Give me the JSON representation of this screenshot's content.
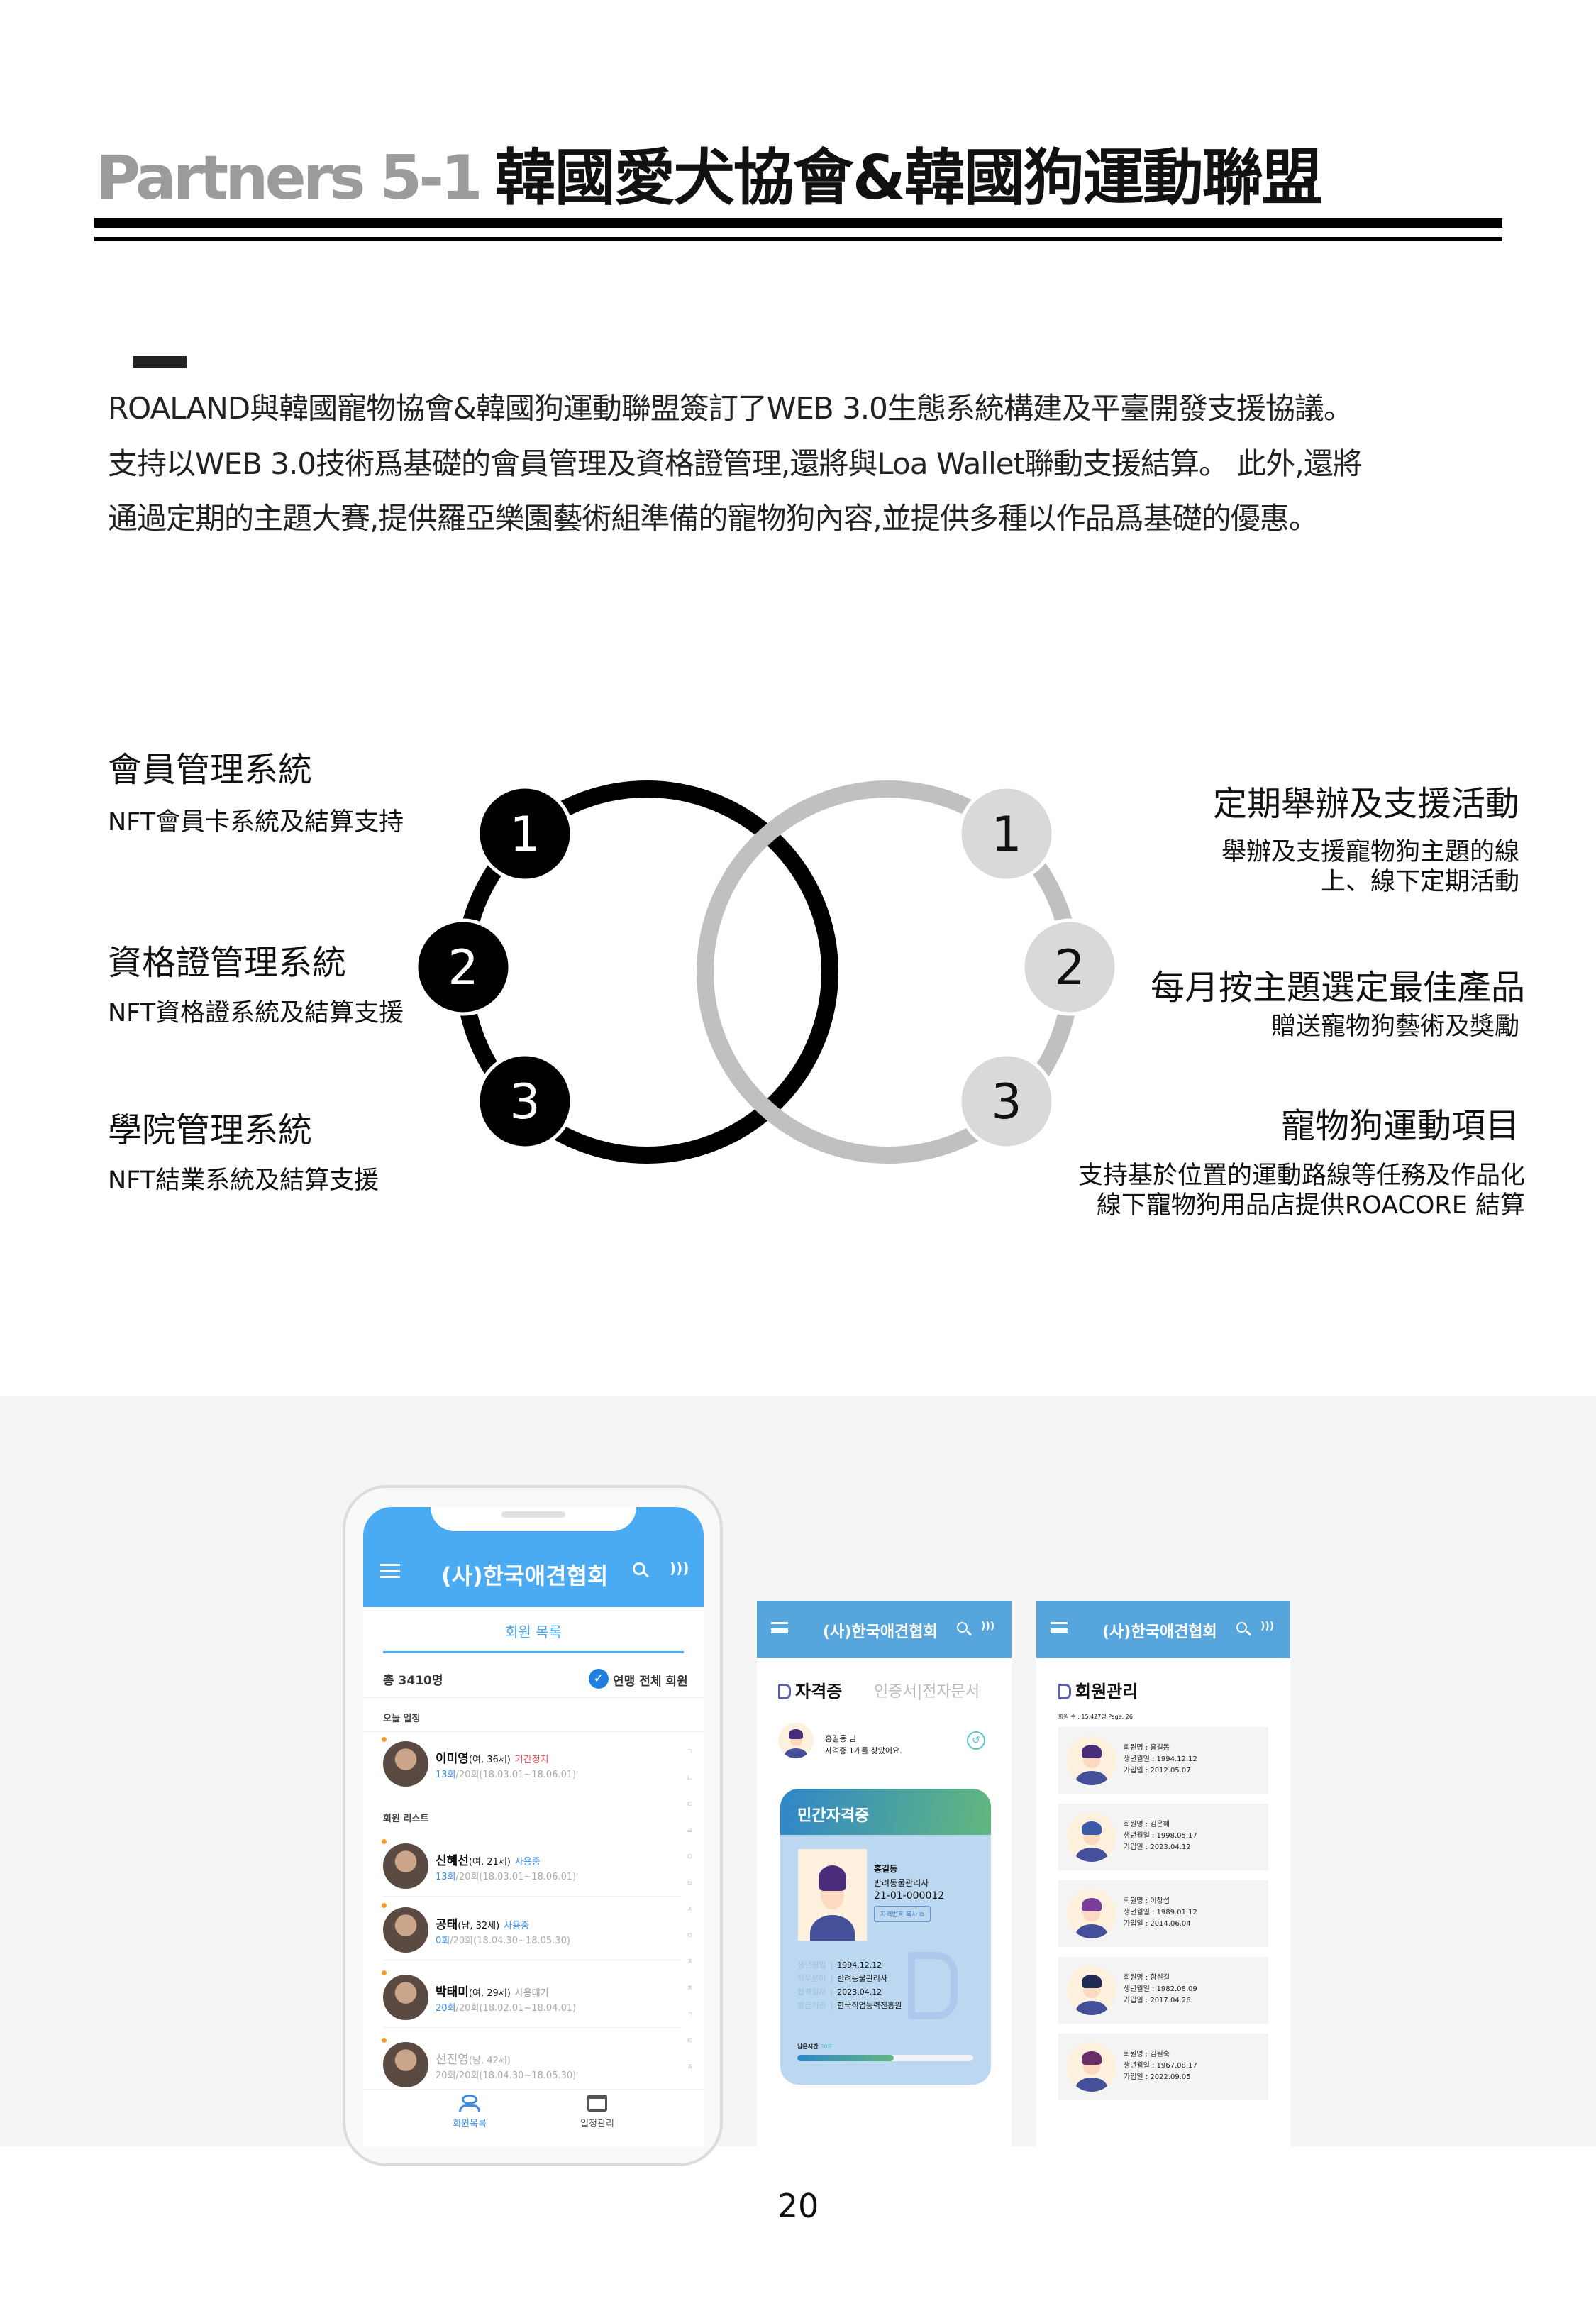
{
  "header": {
    "prefix": "Partners 5-1",
    "title": "韓國愛犬協會&韓國狗運動聯盟"
  },
  "intro": [
    "ROALAND與韓國寵物協會&韓國狗運動聯盟簽訂了WEB 3.0生態系統構建及平臺開發支援協議。",
    "支持以WEB 3.0技術爲基礎的會員管理及資格證管理,還將與Loa Wallet聯動支援結算。 此外,還將",
    "通過定期的主題大賽,提供羅亞樂園藝術組準備的寵物狗內容,並提供多種以作品爲基礎的優惠。"
  ],
  "diagram": {
    "colors": {
      "left": "#000000",
      "right": "#c0c0c0",
      "right_node": "#d9d9d9"
    },
    "left": [
      {
        "num": "1",
        "title": "會員管理系統",
        "desc": "NFT會員卡系統及結算支持"
      },
      {
        "num": "2",
        "title": "資格證管理系統",
        "desc": "NFT資格證系統及結算支援"
      },
      {
        "num": "3",
        "title": "學院管理系統",
        "desc": "NFT結業系統及結算支援"
      }
    ],
    "right": [
      {
        "num": "1",
        "title": "定期舉辦及支援活動",
        "desc": [
          "舉辦及支援寵物狗主題的線",
          "上、線下定期活動"
        ]
      },
      {
        "num": "2",
        "title": "每月按主題選定最佳產品",
        "desc": [
          "贈送寵物狗藝術及獎勵"
        ]
      },
      {
        "num": "3",
        "title": "寵物狗運動項目",
        "desc": [
          "支持基於位置的運動路線等任務及作品化",
          "線下寵物狗用品店提供ROACORE 結算"
        ]
      }
    ]
  },
  "phone1": {
    "app_title": "(사)한국애견협회",
    "tab": "회원 목록",
    "total": "총 3410명",
    "filter": "연맹 전체 회원",
    "section_today": "오늘 일정",
    "section_list": "회원 리스트",
    "members": [
      {
        "name": "이미영",
        "meta": "(여, 36세)",
        "status": "기간정지",
        "status_color": "#f05454",
        "count": "13회",
        "period": "/20회(18.03.01~18.06.01)"
      },
      {
        "name": "신혜선",
        "meta": "(여, 21세)",
        "status": "사용중",
        "status_color": "#3b8de6",
        "count": "13회",
        "period": "/20회(18.03.01~18.06.01)"
      },
      {
        "name": "공태",
        "meta": "(남, 32세)",
        "status": "사용중",
        "status_color": "#3b8de6",
        "count": "0회",
        "period": "/20회(18.04.30~18.05.30)"
      },
      {
        "name": "박태미",
        "meta": "(여, 29세)",
        "status": "사용대기",
        "status_color": "#999999",
        "count": "20회",
        "period": "/20회(18.02.01~18.04.01)"
      },
      {
        "name": "선진영",
        "meta": "(남, 42세)",
        "status": "",
        "status_color": "#999999",
        "count": "20회",
        "period": "/20회(18.04.30~18.05.30)"
      }
    ],
    "index": [
      "ㄱ",
      "ㄴ",
      "ㄷ",
      "ㄹ",
      "ㅁ",
      "ㅂ",
      "ㅅ",
      "ㅇ",
      "ㅈ",
      "ㅊ",
      "ㅋ",
      "ㅌ",
      "ㅎ"
    ],
    "nav": [
      {
        "label": "회원목록",
        "icon": "user-icon"
      },
      {
        "label": "일정관리",
        "icon": "calendar-icon"
      }
    ],
    "accent": "#4aaaf2"
  },
  "screen2": {
    "app_title": "(사)한국애견협회",
    "tab_active": "자격증",
    "tab_inactive": "인증서|전자문서",
    "user_name": "홍길동 님",
    "user_msg": "자격증 1개를 찾았어요.",
    "card_title": "민간자격증",
    "holder_name": "홍길동",
    "holder_job": "반려동물관리사",
    "cert_no": "21-01-000012",
    "copy_label": "자격번호 복사",
    "details": [
      {
        "label": "생년월일",
        "value": "1994.12.12"
      },
      {
        "label": "직무분야",
        "value": "반려동물관리사"
      },
      {
        "label": "합격일자",
        "value": "2023.04.12"
      },
      {
        "label": "발급기관",
        "value": "한국직업능력진흥원"
      }
    ],
    "timer_label": "남은시간",
    "timer_value": "30초",
    "timer_progress": 0.55
  },
  "screen3": {
    "app_title": "(사)한국애견협회",
    "title": "회원관리",
    "count": "회원 수 : 15,427명 Page. 26",
    "members": [
      {
        "name": "회원명 : 홍길동",
        "birth": "생년월일 : 1994.12.12",
        "joined": "가입일 : 2012.05.07"
      },
      {
        "name": "회원명 : 김은혜",
        "birth": "생년월일 : 1998.05.17",
        "joined": "가입일 : 2023.04.12"
      },
      {
        "name": "회원명 : 이창섭",
        "birth": "생년월일 : 1989.01.12",
        "joined": "가입일 : 2014.06.04"
      },
      {
        "name": "회원명 : 함원길",
        "birth": "생년월일 : 1982.08.09",
        "joined": "가입일 : 2017.04.26"
      },
      {
        "name": "회원명 : 김원숙",
        "birth": "생년월일 : 1967.08.17",
        "joined": "가입일 : 2022.09.05"
      }
    ]
  },
  "page_number": "20"
}
